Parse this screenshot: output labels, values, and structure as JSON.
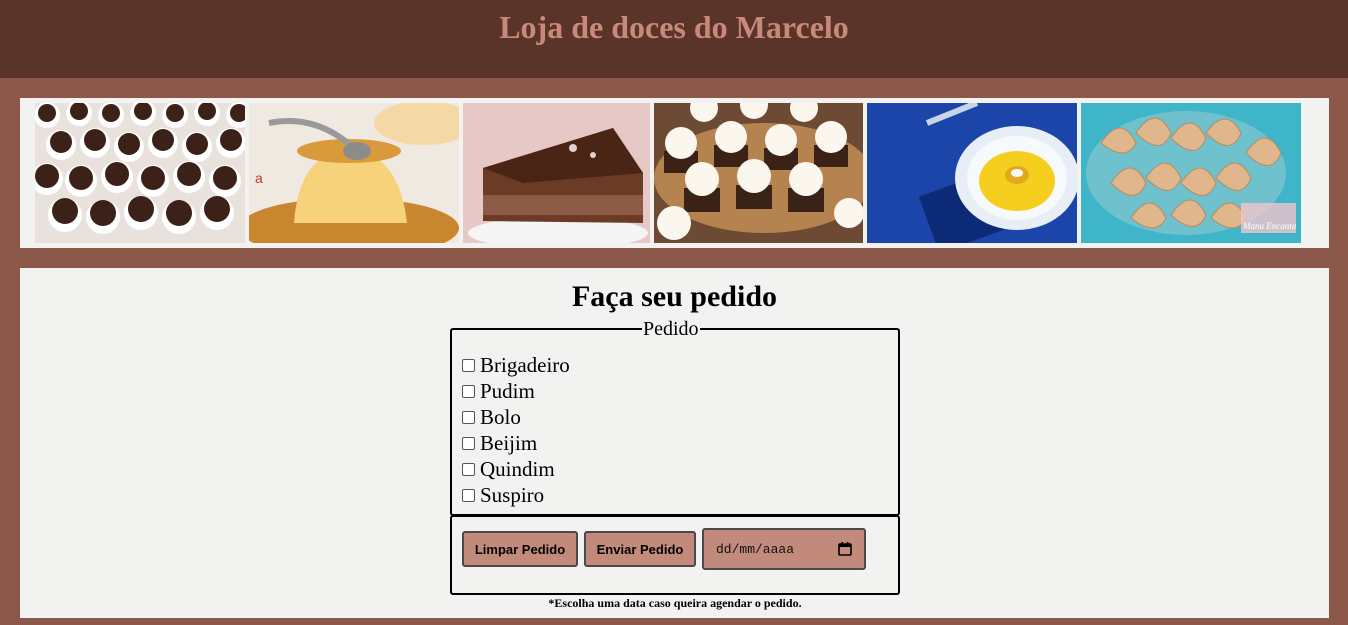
{
  "header": {
    "title": "Loja de doces do Marcelo"
  },
  "gallery": {
    "photos": [
      {
        "name": "Brigadeiro"
      },
      {
        "name": "Pudim"
      },
      {
        "name": "Bolo"
      },
      {
        "name": "Beijim"
      },
      {
        "name": "Quindim"
      },
      {
        "name": "Suspiro",
        "watermark": "Manu Encanta"
      }
    ]
  },
  "order": {
    "title": "Faça seu pedido",
    "legend": "Pedido",
    "options": [
      {
        "label": "Brigadeiro",
        "checked": false
      },
      {
        "label": "Pudim",
        "checked": false
      },
      {
        "label": "Bolo",
        "checked": false
      },
      {
        "label": "Beijim",
        "checked": false
      },
      {
        "label": "Quindim",
        "checked": false
      },
      {
        "label": "Suspiro",
        "checked": false
      }
    ],
    "clear_label": "Limpar Pedido",
    "submit_label": "Enviar Pedido",
    "date_placeholder": "dd/mm/aaaa",
    "note": "*Escolha uma data caso queira agendar o pedido."
  },
  "colors": {
    "page_bg": "#8b5849",
    "header_bg": "#5a3428",
    "title_color": "#c7897a",
    "panel_bg": "#f2f2f0",
    "button_bg": "#c18a7a"
  }
}
